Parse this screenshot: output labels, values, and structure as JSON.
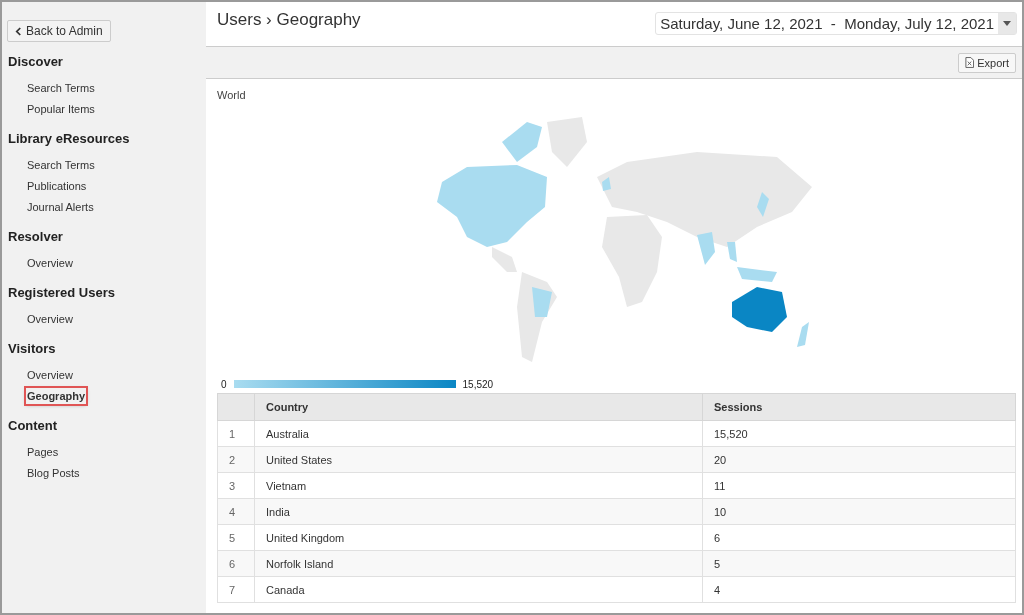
{
  "sidebar": {
    "back_button": "Back to Admin",
    "sections": [
      {
        "title": "Discover",
        "items": [
          {
            "label": "Search Terms",
            "selected": false
          },
          {
            "label": "Popular Items",
            "selected": false
          }
        ]
      },
      {
        "title": "Library eResources",
        "items": [
          {
            "label": "Search Terms",
            "selected": false
          },
          {
            "label": "Publications",
            "selected": false
          },
          {
            "label": "Journal Alerts",
            "selected": false
          }
        ]
      },
      {
        "title": "Resolver",
        "items": [
          {
            "label": "Overview",
            "selected": false
          }
        ]
      },
      {
        "title": "Registered Users",
        "items": [
          {
            "label": "Overview",
            "selected": false
          }
        ]
      },
      {
        "title": "Visitors",
        "items": [
          {
            "label": "Overview",
            "selected": false
          },
          {
            "label": "Geography",
            "selected": true
          }
        ]
      },
      {
        "title": "Content",
        "items": [
          {
            "label": "Pages",
            "selected": false
          },
          {
            "label": "Blog Posts",
            "selected": false
          }
        ]
      }
    ]
  },
  "header": {
    "breadcrumb": "Users › Geography",
    "date_range": {
      "start": "Saturday, June 12, 2021",
      "separator": "-",
      "end": "Monday, July 12, 2021"
    }
  },
  "toolbar": {
    "export_button": "Export"
  },
  "map": {
    "title": "World",
    "legend_min": "0",
    "legend_max": "15,520"
  },
  "table": {
    "columns": [
      "",
      "Country",
      "Sessions"
    ],
    "rows": [
      [
        "1",
        "Australia",
        "15,520"
      ],
      [
        "2",
        "United States",
        "20"
      ],
      [
        "3",
        "Vietnam",
        "11"
      ],
      [
        "4",
        "India",
        "10"
      ],
      [
        "5",
        "United Kingdom",
        "6"
      ],
      [
        "6",
        "Norfolk Island",
        "5"
      ],
      [
        "7",
        "Canada",
        "4"
      ]
    ]
  }
}
